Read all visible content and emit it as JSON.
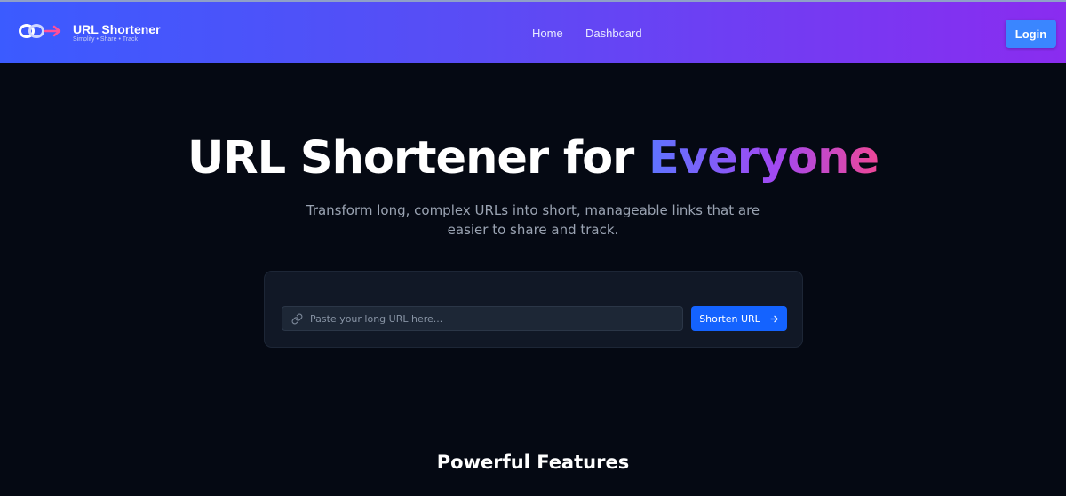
{
  "nav": {
    "brand_title": "URL Shortener",
    "brand_tagline": "Simplify • Share • Track",
    "logo_icon": "link-chain-arrow-icon",
    "links": [
      {
        "label": "Home"
      },
      {
        "label": "Dashboard"
      }
    ],
    "login_label": "Login",
    "gradient": [
      "#3b5bff",
      "#8a2cf0"
    ]
  },
  "hero": {
    "title_main": "URL Shortener for ",
    "title_accent": "Everyone",
    "accent_gradient": [
      "#5e74ff",
      "#a149f2",
      "#ee4797"
    ],
    "subtitle": "Transform long, complex URLs into short, manageable links that are easier to share and track."
  },
  "shortener": {
    "input_icon": "link-icon",
    "input_placeholder": "Paste your long URL here...",
    "input_value": "",
    "button_label": "Shorten URL",
    "button_icon": "arrow-right-icon",
    "button_color": "#1463ff"
  },
  "features": {
    "heading": "Powerful Features"
  }
}
